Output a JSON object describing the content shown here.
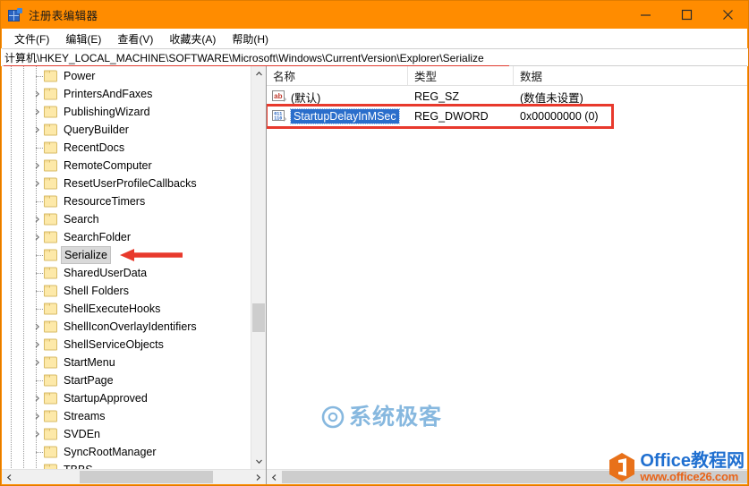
{
  "window": {
    "title": "注册表编辑器",
    "app_icon": "registry-editor-icon",
    "accent_color": "#ff8c00",
    "controls": {
      "minimize": "minimize-icon",
      "maximize": "maximize-icon",
      "close": "close-icon"
    }
  },
  "menubar": {
    "items": [
      {
        "label": "文件(F)"
      },
      {
        "label": "编辑(E)"
      },
      {
        "label": "查看(V)"
      },
      {
        "label": "收藏夹(A)"
      },
      {
        "label": "帮助(H)"
      }
    ]
  },
  "address": {
    "path": "计算机\\HKEY_LOCAL_MACHINE\\SOFTWARE\\Microsoft\\Windows\\CurrentVersion\\Explorer\\Serialize"
  },
  "tree": {
    "items": [
      {
        "label": "Power",
        "expandable": false,
        "selected": false
      },
      {
        "label": "PrintersAndFaxes",
        "expandable": true,
        "selected": false
      },
      {
        "label": "PublishingWizard",
        "expandable": true,
        "selected": false
      },
      {
        "label": "QueryBuilder",
        "expandable": true,
        "selected": false
      },
      {
        "label": "RecentDocs",
        "expandable": false,
        "selected": false
      },
      {
        "label": "RemoteComputer",
        "expandable": true,
        "selected": false
      },
      {
        "label": "ResetUserProfileCallbacks",
        "expandable": true,
        "selected": false
      },
      {
        "label": "ResourceTimers",
        "expandable": false,
        "selected": false
      },
      {
        "label": "Search",
        "expandable": true,
        "selected": false
      },
      {
        "label": "SearchFolder",
        "expandable": true,
        "selected": false
      },
      {
        "label": "Serialize",
        "expandable": false,
        "selected": true
      },
      {
        "label": "SharedUserData",
        "expandable": false,
        "selected": false
      },
      {
        "label": "Shell Folders",
        "expandable": false,
        "selected": false
      },
      {
        "label": "ShellExecuteHooks",
        "expandable": false,
        "selected": false
      },
      {
        "label": "ShellIconOverlayIdentifiers",
        "expandable": true,
        "selected": false
      },
      {
        "label": "ShellServiceObjects",
        "expandable": true,
        "selected": false
      },
      {
        "label": "StartMenu",
        "expandable": true,
        "selected": false
      },
      {
        "label": "StartPage",
        "expandable": false,
        "selected": false
      },
      {
        "label": "StartupApproved",
        "expandable": true,
        "selected": false
      },
      {
        "label": "Streams",
        "expandable": true,
        "selected": false
      },
      {
        "label": "SVDEn",
        "expandable": true,
        "selected": false
      },
      {
        "label": "SyncRootManager",
        "expandable": false,
        "selected": false
      },
      {
        "label": "TBBS",
        "expandable": false,
        "selected": false
      }
    ]
  },
  "values": {
    "columns": [
      {
        "label": "名称"
      },
      {
        "label": "类型"
      },
      {
        "label": "数据"
      }
    ],
    "rows": [
      {
        "icon": "string-value-icon",
        "name": "(默认)",
        "type": "REG_SZ",
        "data": "(数值未设置)",
        "selected": false
      },
      {
        "icon": "dword-value-icon",
        "name": "StartupDelayInMSec",
        "type": "REG_DWORD",
        "data": "0x00000000 (0)",
        "selected": true
      }
    ]
  },
  "annotations": {
    "highlight_color": "#e8392c",
    "arrow_target": "Serialize",
    "box_target": "StartupDelayInMSec"
  },
  "watermarks": {
    "center": {
      "text": "系统极客",
      "color": "#7db3dd",
      "icon": "circle-swirl-icon"
    },
    "corner": {
      "line1": "Office教程网",
      "line2": "www.office26.com",
      "icon": "office-hex-icon"
    }
  }
}
